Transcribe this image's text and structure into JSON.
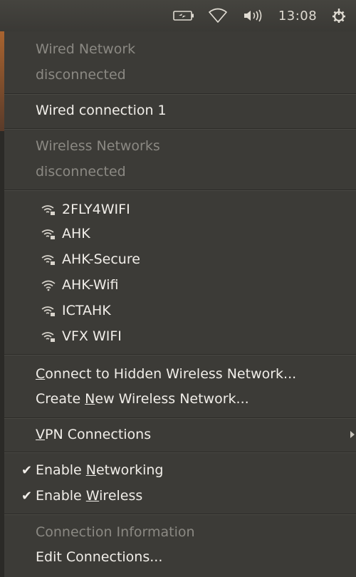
{
  "panel": {
    "clock": "13:08",
    "icons": [
      "battery-icon",
      "wifi-signal-icon",
      "volume-icon",
      "power-gear-icon"
    ]
  },
  "menu": {
    "wired_header": "Wired Network",
    "wired_status": "disconnected",
    "wired_connection": "Wired connection 1",
    "wireless_header": "Wireless Networks",
    "wireless_status": "disconnected",
    "networks": [
      {
        "name": "2FLY4WIFI",
        "secure": true
      },
      {
        "name": "AHK",
        "secure": true
      },
      {
        "name": "AHK-Secure",
        "secure": true
      },
      {
        "name": "AHK-Wifi",
        "secure": false
      },
      {
        "name": "ICTAHK",
        "secure": true
      },
      {
        "name": "VFX WIFI",
        "secure": true
      }
    ],
    "connect_hidden": {
      "mnemonic": "C",
      "rest": "onnect to Hidden Wireless Network..."
    },
    "create_new": {
      "pre": "Create ",
      "mnemonic": "N",
      "rest": "ew Wireless Network..."
    },
    "vpn": {
      "mnemonic": "V",
      "rest": "PN Connections"
    },
    "enable_networking": {
      "pre": "Enable ",
      "mnemonic": "N",
      "rest": "etworking",
      "checked": true
    },
    "enable_wireless": {
      "pre": "Enable ",
      "mnemonic": "W",
      "rest": "ireless",
      "checked": true
    },
    "connection_info": "Connection Information",
    "edit_connections": "Edit Connections..."
  },
  "colors": {
    "menu_bg": "#3c3b37",
    "text": "#f1eee9",
    "disabled_text": "#8b8983"
  }
}
